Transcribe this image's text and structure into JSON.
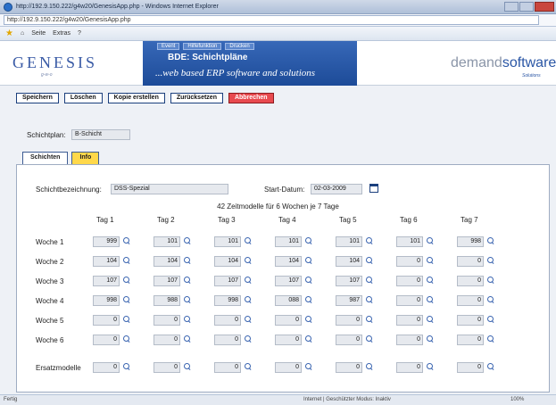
{
  "window": {
    "title": "http://192.9.150.222/g4w20/GenesisApp.php - Windows Internet Explorer",
    "url": "http://192.9.150.222/g4w20/GenesisApp.php"
  },
  "ie_toolbar": {
    "page_menu": "Seite",
    "extras_menu": "Extras"
  },
  "header": {
    "logo_text": "GENESIS",
    "logo_sub": "g-w-o",
    "banner_buttons": [
      "Event",
      "Hilfefunktion",
      "Drucken"
    ],
    "banner_title": "BDE: Schichtpläne",
    "banner_slogan": "...web based ERP software and solutions",
    "vendor_logo_a": "demand",
    "vendor_logo_b": "software",
    "vendor_sub": "Solutions"
  },
  "actions": {
    "save": "Speichern",
    "delete": "Löschen",
    "copy": "Kopie erstellen",
    "reset": "Zurücksetzen",
    "cancel": "Abbrechen"
  },
  "schichtplan": {
    "label": "Schichtplan:",
    "value": "B-Schicht"
  },
  "tabs": {
    "shifts": "Schichten",
    "info": "Info"
  },
  "form": {
    "bezeichnung_label": "Schichtbezeichnung:",
    "bezeichnung_value": "DSS-Spezial",
    "start_label": "Start-Datum:",
    "start_value": "02-03-2009"
  },
  "summary": "42 Zeitmodelle für 6 Wochen je 7 Tage",
  "grid": {
    "days": [
      "Tag 1",
      "Tag 2",
      "Tag 3",
      "Tag 4",
      "Tag 5",
      "Tag 6",
      "Tag 7"
    ],
    "rows": [
      {
        "label": "Woche 1",
        "values": [
          "999",
          "101",
          "101",
          "101",
          "101",
          "101",
          "998"
        ]
      },
      {
        "label": "Woche 2",
        "values": [
          "104",
          "104",
          "104",
          "104",
          "104",
          "0",
          "0"
        ]
      },
      {
        "label": "Woche 3",
        "values": [
          "107",
          "107",
          "107",
          "107",
          "107",
          "0",
          "0"
        ]
      },
      {
        "label": "Woche 4",
        "values": [
          "998",
          "988",
          "998",
          "088",
          "987",
          "0",
          "0"
        ]
      },
      {
        "label": "Woche 5",
        "values": [
          "0",
          "0",
          "0",
          "0",
          "0",
          "0",
          "0"
        ]
      },
      {
        "label": "Woche 6",
        "values": [
          "0",
          "0",
          "0",
          "0",
          "0",
          "0",
          "0"
        ]
      }
    ],
    "ersatz": {
      "label": "Ersatzmodelle",
      "values": [
        "0",
        "0",
        "0",
        "0",
        "0",
        "0",
        "0"
      ]
    }
  },
  "status": {
    "left": "Fertig",
    "middle": "Internet | Geschützter Modus: Inaktiv",
    "zoom": "100%"
  }
}
